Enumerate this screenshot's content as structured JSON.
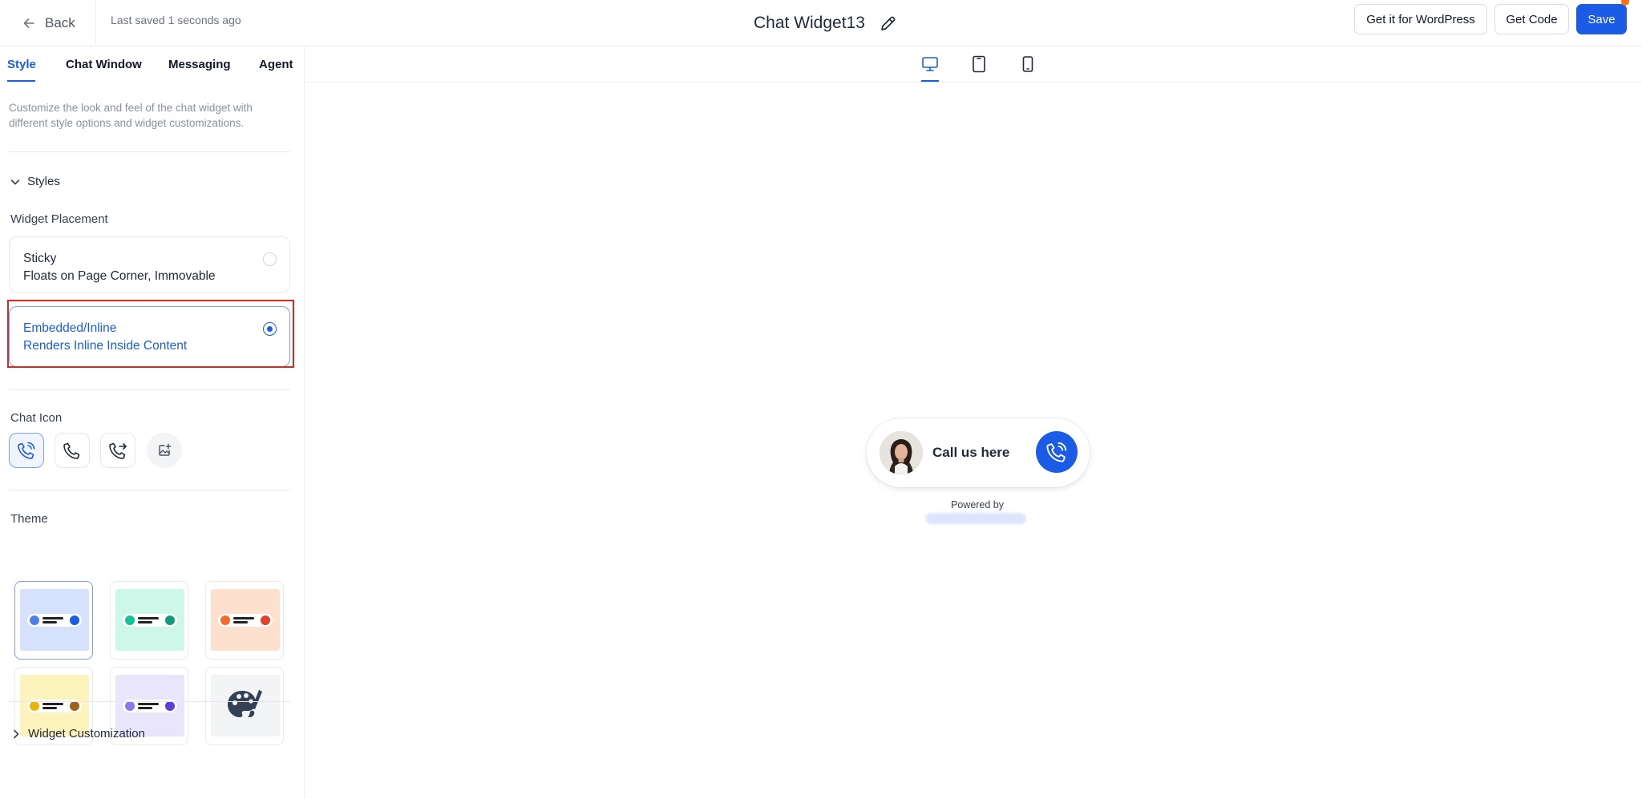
{
  "header": {
    "back_label": "Back",
    "last_saved": "Last saved 1 seconds ago",
    "title": "Chat Widget13",
    "buttons": {
      "wordpress": "Get it for WordPress",
      "get_code": "Get Code",
      "save": "Save"
    }
  },
  "tabs": [
    {
      "label": "Style",
      "active": true
    },
    {
      "label": "Chat Window",
      "active": false
    },
    {
      "label": "Messaging",
      "active": false
    },
    {
      "label": "Agent",
      "active": false
    }
  ],
  "style_panel": {
    "description": "Customize the look and feel of the chat widget with different style options and widget customizations.",
    "styles_section": "Styles",
    "widget_placement": {
      "label": "Widget Placement",
      "options": [
        {
          "title": "Sticky",
          "subtitle": "Floats on Page Corner, Immovable",
          "selected": false
        },
        {
          "title": "Embedded/Inline",
          "subtitle": "Renders Inline Inside Content",
          "selected": true
        }
      ]
    },
    "chat_icon": {
      "label": "Chat Icon",
      "options": [
        "phone-ringing-icon",
        "phone-icon",
        "phone-forward-icon",
        "image-upload-icon"
      ],
      "selected_index": 0
    },
    "theme": {
      "label": "Theme",
      "selected_index": 0,
      "options": [
        {
          "bg": "#d6e2fd",
          "left_dot": "#4f7ef0",
          "right_dot": "#1b5ce6"
        },
        {
          "bg": "#cdf7e9",
          "left_dot": "#14c29a",
          "right_dot": "#0f9c78"
        },
        {
          "bg": "#fde0cd",
          "left_dot": "#f26a2e",
          "right_dot": "#e0412c"
        },
        {
          "bg": "#fdf3bd",
          "left_dot": "#eab308",
          "right_dot": "#a06318"
        },
        {
          "bg": "#e9e6fb",
          "left_dot": "#8b78ec",
          "right_dot": "#5b3fd6"
        },
        {
          "bg": "#f3f4f6",
          "custom": "palette-icon"
        }
      ]
    },
    "widget_customization": "Widget Customization"
  },
  "preview": {
    "devices": [
      "desktop-icon",
      "tablet-icon",
      "mobile-icon"
    ],
    "active_device": "desktop",
    "widget": {
      "label": "Call us here",
      "button_color": "#1b5ce6"
    },
    "powered_by": "Powered by"
  },
  "colors": {
    "accent": "#1b5ce6",
    "highlight": "#e0281f",
    "notification": "#f97316"
  }
}
